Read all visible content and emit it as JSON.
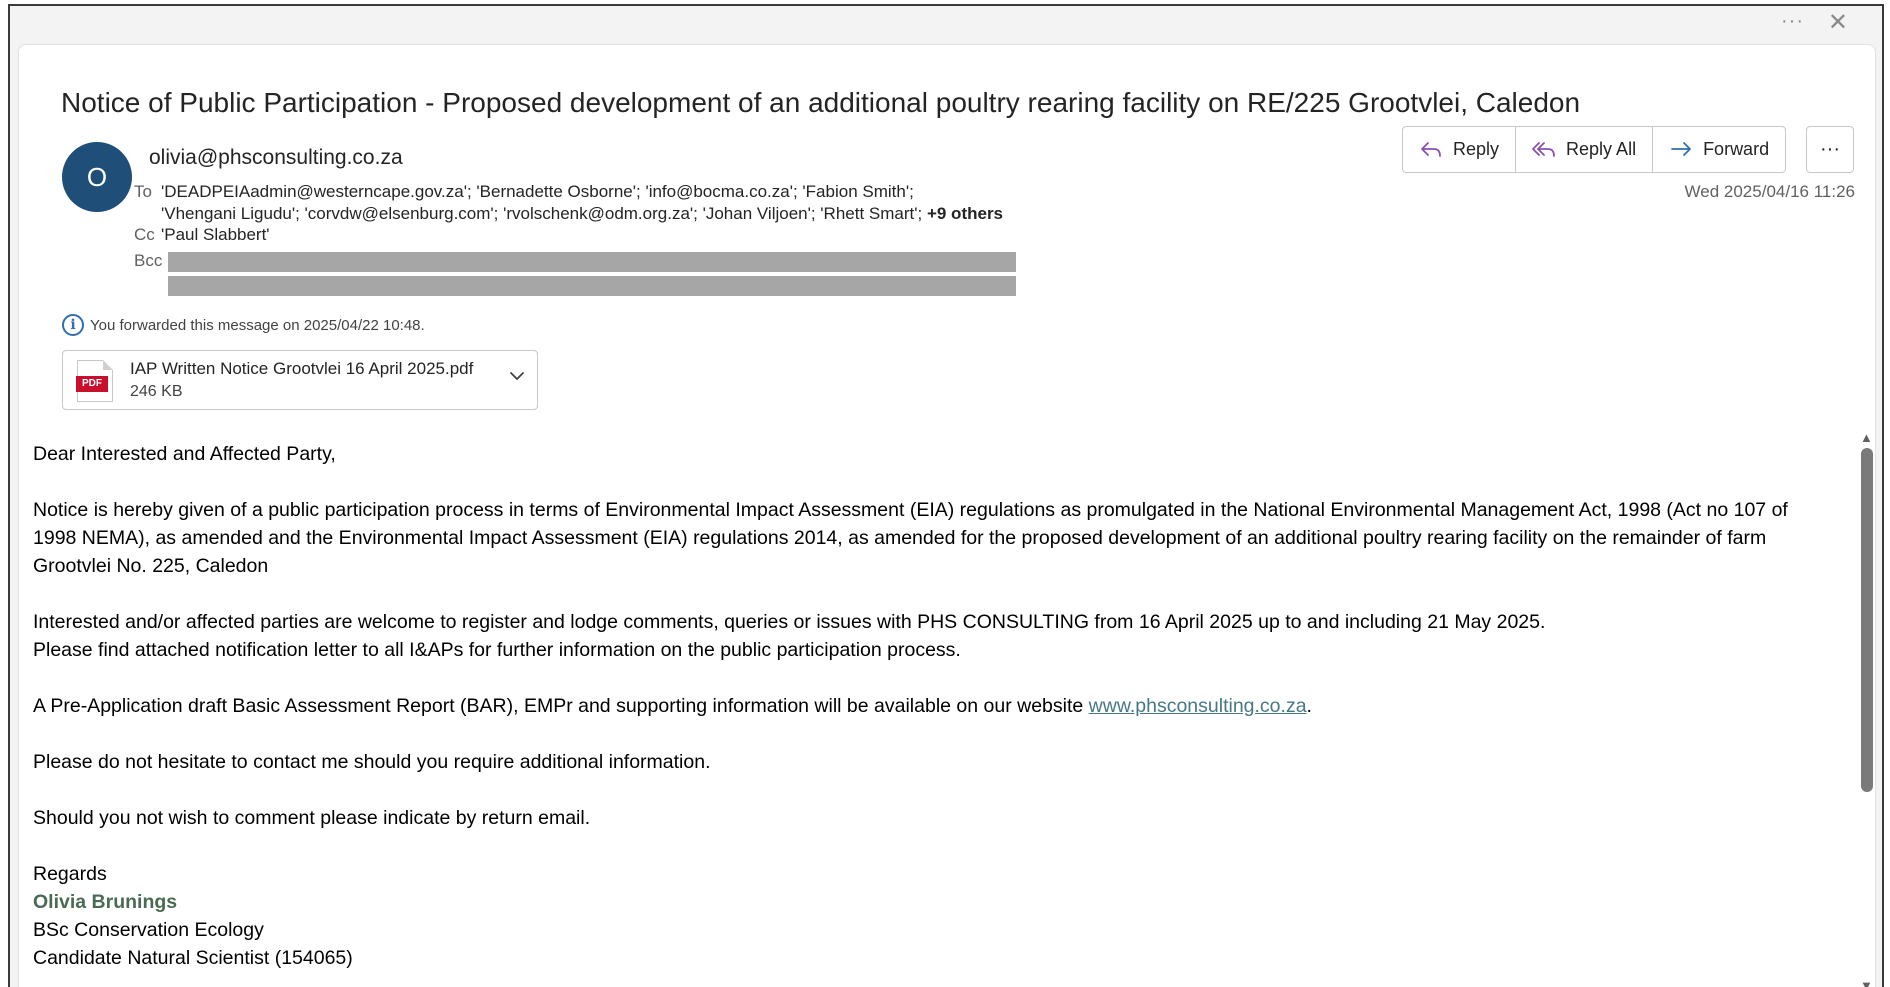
{
  "titlebar": {
    "more_icon": "···",
    "close_icon": "✕"
  },
  "email": {
    "subject": "Notice of Public Participation - Proposed development of an additional poultry rearing facility on RE/225 Grootvlei, Caledon",
    "avatar_initial": "O",
    "avatar_color": "#1f4e79",
    "sender": "olivia@phsconsulting.co.za",
    "to_label": "To",
    "to_line1": "'DEADPEIAadmin@westerncape.gov.za'; 'Bernadette Osborne'; 'info@bocma.co.za'; 'Fabion Smith';",
    "to_line2": "'Vhengani Ligudu'; 'corvdw@elsenburg.com'; 'rvolschenk@odm.org.za'; 'Johan Viljoen'; 'Rhett Smart';",
    "to_others": "+9 others",
    "cc_label": "Cc",
    "cc": "'Paul Slabbert'",
    "bcc_label": "Bcc",
    "date": "Wed 2025/04/16 11:26",
    "forwarded_info": "You forwarded this message on 2025/04/22 10:48."
  },
  "actions": {
    "reply": "Reply",
    "reply_all": "Reply All",
    "forward": "Forward",
    "more": "···",
    "icon_color": "#8a4fb5",
    "forward_icon_color": "#2f6fad"
  },
  "attachment": {
    "type_badge": "PDF",
    "name": "IAP Written Notice Grootvlei 16 April 2025.pdf",
    "size": "246 KB"
  },
  "body": {
    "greeting": "Dear Interested and Affected Party,",
    "para1": "Notice is hereby given of a public participation process in terms of Environmental Impact Assessment (EIA) regulations as promulgated in the National Environmental Management Act, 1998 (Act no 107 of 1998 NEMA), as amended and the Environmental Impact Assessment (EIA) regulations 2014, as amended for the proposed development of an additional poultry rearing facility on the remainder of farm Grootvlei No. 225, Caledon",
    "para2_line1": "Interested and/or affected parties are welcome to register and lodge comments, queries or issues with PHS CONSULTING from 16 April 2025 up to and including 21 May 2025.",
    "para2_line2": "Please find attached notification letter to all I&APs for further information on the public participation process.",
    "para3_before": "A Pre-Application draft Basic Assessment Report (BAR), EMPr and supporting information will be available on our website ",
    "para3_link": "www.phsconsulting.co.za",
    "para3_after": ".",
    "para4": "Please do not hesitate to contact me should you require additional information.",
    "para5": "Should you not wish to comment please indicate by return email.",
    "regards": "Regards",
    "sig_name": "Olivia Brunings",
    "sig_line1": "BSc Conservation Ecology",
    "sig_line2": "Candidate Natural Scientist (154065)"
  }
}
